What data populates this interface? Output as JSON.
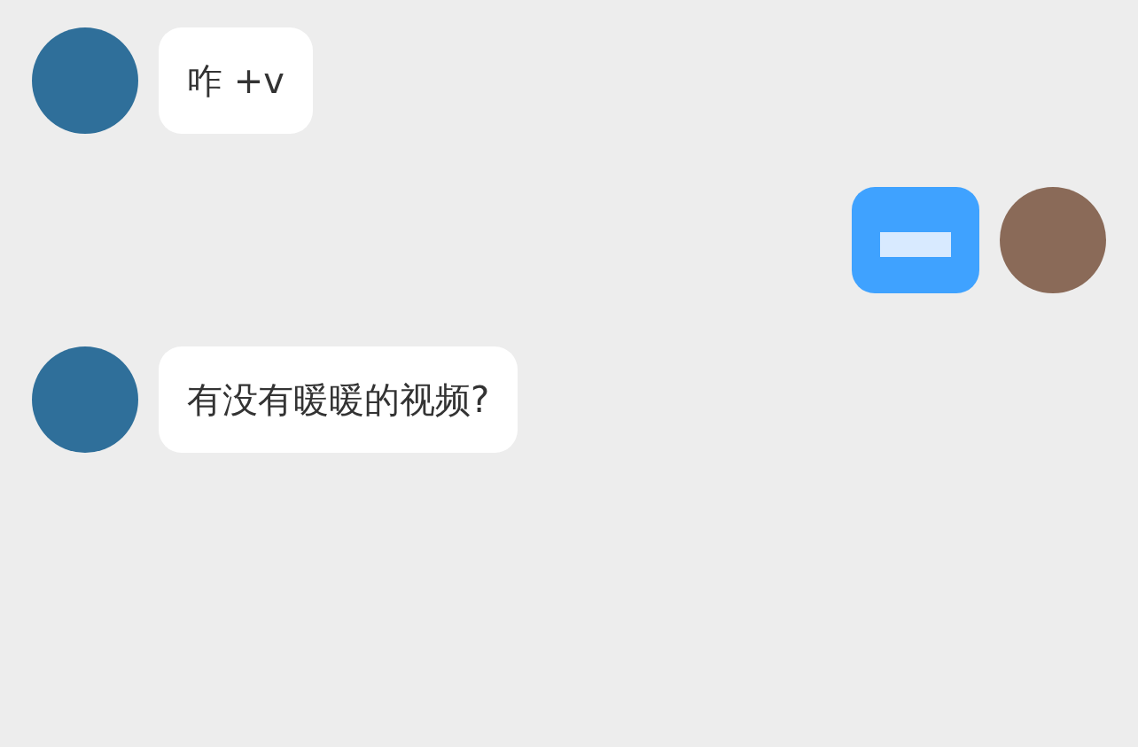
{
  "messages": [
    {
      "outgoing": false,
      "kind": "text",
      "text": "咋 +v"
    },
    {
      "outgoing": true,
      "kind": "redacted"
    },
    {
      "outgoing": false,
      "kind": "text",
      "text": "有没有暖暖的视频?"
    }
  ]
}
